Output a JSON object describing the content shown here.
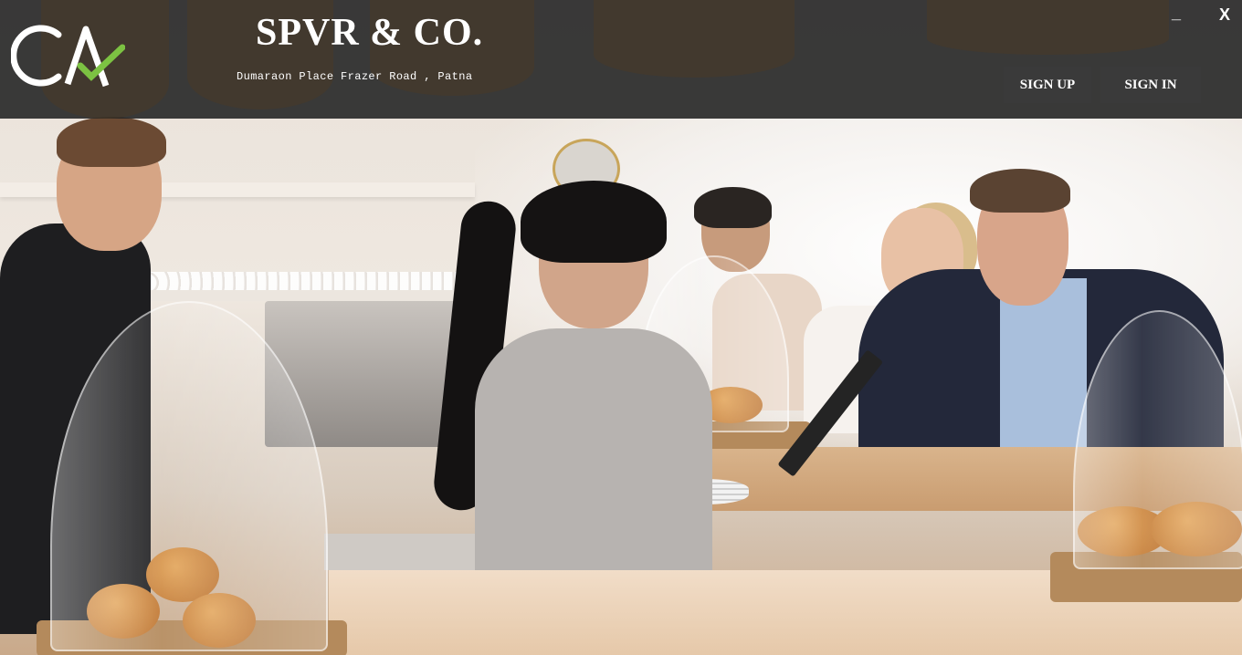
{
  "window": {
    "minimize_label": "_",
    "close_label": "X"
  },
  "header": {
    "logo_icon": "ca-logo-icon",
    "title": "SPVR & CO.",
    "address": "Dumaraon Place Frazer Road , Patna"
  },
  "nav": {
    "signup_label": "SIGN UP",
    "signin_label": "SIGN IN"
  },
  "colors": {
    "header_bg": "#262626",
    "text": "#ffffff",
    "logo_check": "#7cc242"
  },
  "background": {
    "image_subject": "cafe-counter-photo"
  }
}
